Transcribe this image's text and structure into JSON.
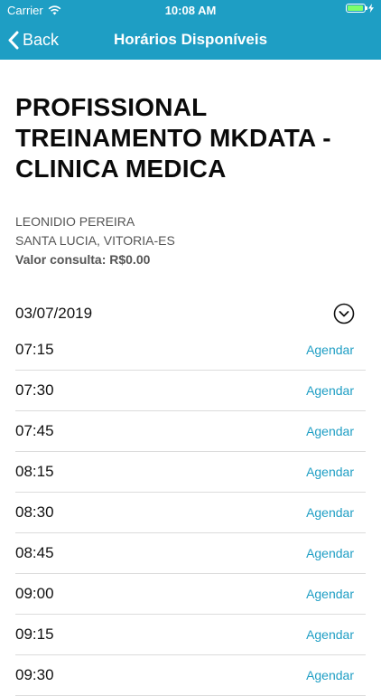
{
  "status_bar": {
    "carrier": "Carrier",
    "time": "10:08 AM",
    "battery_level": 0.85,
    "battery_color": "#7cff6b"
  },
  "nav": {
    "back_label": "Back",
    "title": "Horários Disponíveis",
    "bar_color": "#1e9ec4"
  },
  "professional": {
    "title": "PROFISSIONAL TREINAMENTO MKDATA - CLINICA MEDICA",
    "name": "LEONIDIO PEREIRA",
    "location": "SANTA LUCIA, VITORIA-ES",
    "price": "Valor consulta: R$0.00"
  },
  "date": {
    "value": "03/07/2019",
    "toggle_icon": "chevron-down-circle-icon"
  },
  "slots": [
    {
      "time": "07:15",
      "action": "Agendar"
    },
    {
      "time": "07:30",
      "action": "Agendar"
    },
    {
      "time": "07:45",
      "action": "Agendar"
    },
    {
      "time": "08:15",
      "action": "Agendar"
    },
    {
      "time": "08:30",
      "action": "Agendar"
    },
    {
      "time": "08:45",
      "action": "Agendar"
    },
    {
      "time": "09:00",
      "action": "Agendar"
    },
    {
      "time": "09:15",
      "action": "Agendar"
    },
    {
      "time": "09:30",
      "action": "Agendar"
    }
  ]
}
